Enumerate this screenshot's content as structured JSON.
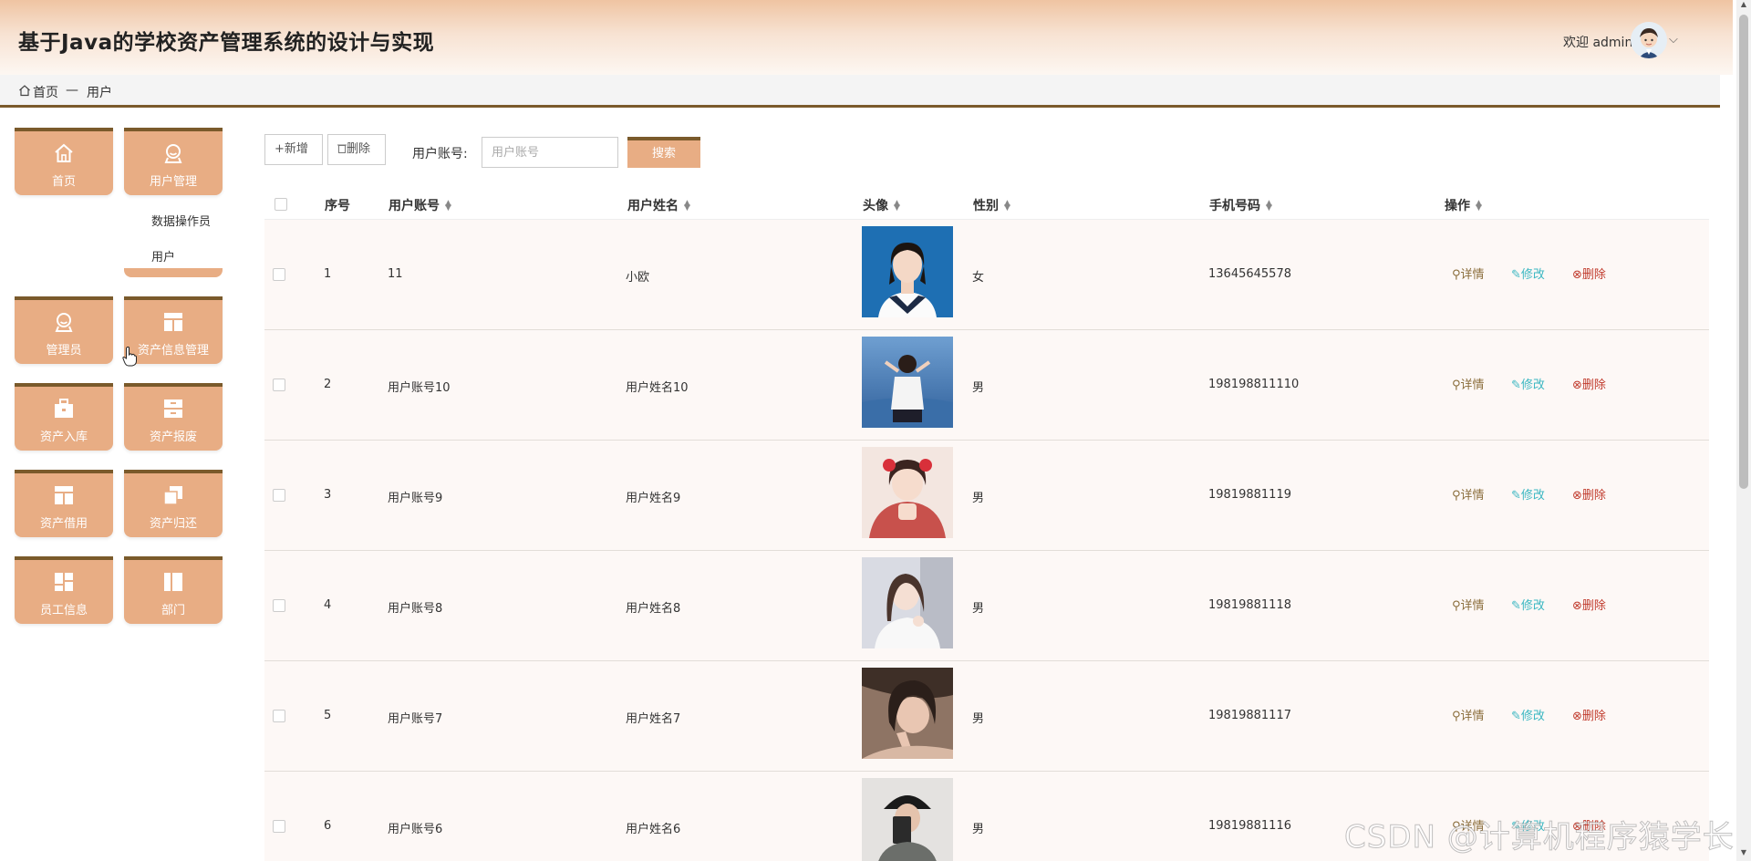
{
  "header": {
    "title": "基于Java的学校资产管理系统的设计与实现",
    "welcome": "欢迎 admin",
    "chevron": "⌵"
  },
  "breadcrumb": {
    "home": "首页",
    "separator": "—",
    "current": "用户"
  },
  "sidebar": {
    "tiles": [
      {
        "label": "首页",
        "icon": "home-icon"
      },
      {
        "label": "用户管理",
        "icon": "user-icon"
      },
      {
        "label": "管理员",
        "icon": "user-icon"
      },
      {
        "label": "资产信息管理",
        "icon": "layout-icon"
      },
      {
        "label": "资产入库",
        "icon": "briefcase-icon"
      },
      {
        "label": "资产报废",
        "icon": "archive-icon"
      },
      {
        "label": "资产借用",
        "icon": "layout-icon"
      },
      {
        "label": "资产归还",
        "icon": "copy-icon"
      },
      {
        "label": "员工信息",
        "icon": "grid-icon"
      },
      {
        "label": "部门",
        "icon": "columns-icon"
      }
    ],
    "submenu": [
      "数据操作员",
      "用户"
    ]
  },
  "toolbar": {
    "add_label": "+新增",
    "delete_label": "删除",
    "search_label": "用户账号:",
    "search_placeholder": "用户账号",
    "search_button": "搜索"
  },
  "table": {
    "columns": [
      "序号",
      "用户账号",
      "用户姓名",
      "头像",
      "性别",
      "手机号码",
      "操作"
    ],
    "rows": [
      {
        "index": "1",
        "account": "11",
        "name": "小欧",
        "gender": "女",
        "phone": "13645645578"
      },
      {
        "index": "2",
        "account": "用户账号10",
        "name": "用户姓名10",
        "gender": "男",
        "phone": "198198811110"
      },
      {
        "index": "3",
        "account": "用户账号9",
        "name": "用户姓名9",
        "gender": "男",
        "phone": "19819881119"
      },
      {
        "index": "4",
        "account": "用户账号8",
        "name": "用户姓名8",
        "gender": "男",
        "phone": "19819881118"
      },
      {
        "index": "5",
        "account": "用户账号7",
        "name": "用户姓名7",
        "gender": "男",
        "phone": "19819881117"
      },
      {
        "index": "6",
        "account": "用户账号6",
        "name": "用户姓名6",
        "gender": "男",
        "phone": "19819881116"
      }
    ],
    "actions": {
      "detail": "详情",
      "edit": "修改",
      "delete": "删除"
    }
  },
  "watermark": "CSDN @计算机程序猿学长",
  "colors": {
    "accent": "#e8ad84",
    "accent_border": "#7a5a2b",
    "edit": "#3bb7c2",
    "delete": "#c0392b",
    "detail": "#8a6d3b"
  }
}
